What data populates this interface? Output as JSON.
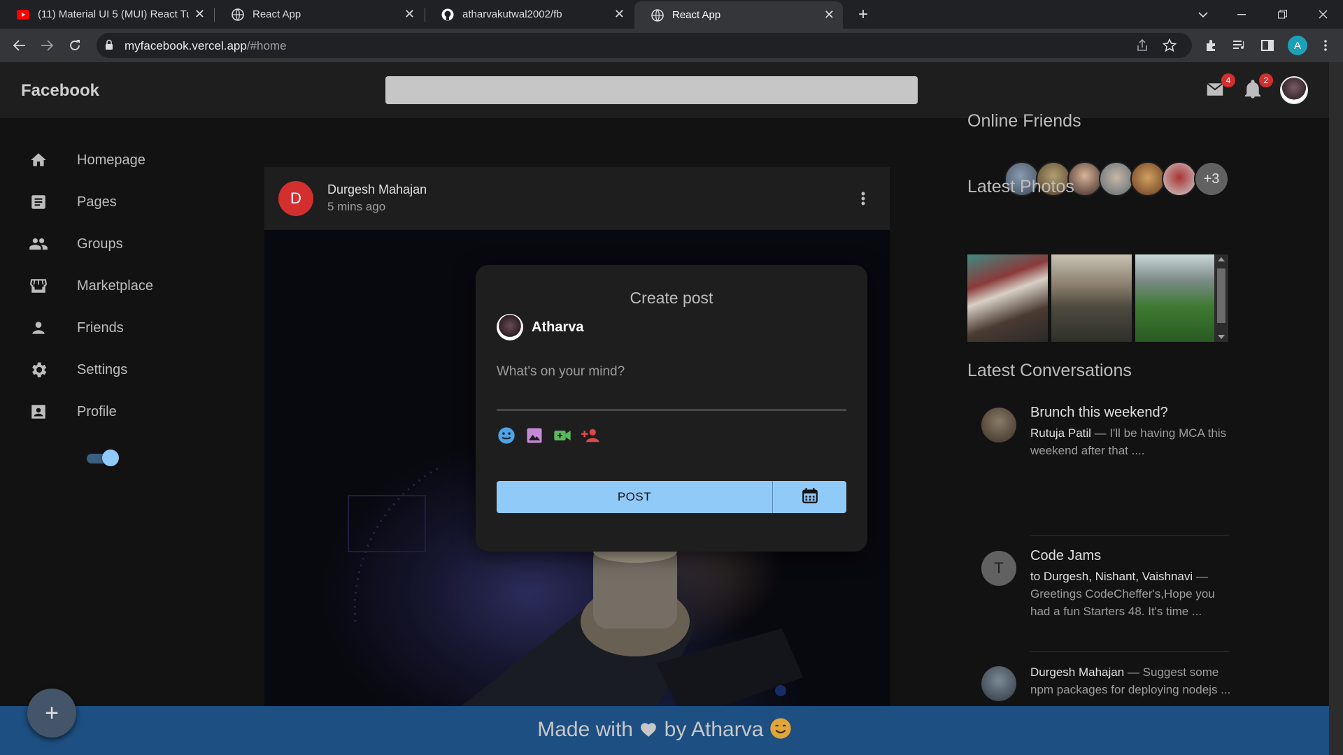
{
  "browser": {
    "tabs": [
      {
        "title": "(11) Material UI 5 (MUI) React Tu",
        "icon": "youtube-icon"
      },
      {
        "title": "React App",
        "icon": "globe-icon"
      },
      {
        "title": "atharvakutwal2002/fb",
        "icon": "github-icon"
      },
      {
        "title": "React App",
        "icon": "globe-icon",
        "active": true
      }
    ],
    "url_host": "myfacebook.vercel.app",
    "url_path": "/#home",
    "profile_letter": "A"
  },
  "appbar": {
    "brand": "Facebook",
    "mail_count": "4",
    "notif_count": "2"
  },
  "sidebar": {
    "items": [
      {
        "label": "Homepage",
        "icon": "home-icon"
      },
      {
        "label": "Pages",
        "icon": "article-icon"
      },
      {
        "label": "Groups",
        "icon": "group-icon"
      },
      {
        "label": "Marketplace",
        "icon": "storefront-icon"
      },
      {
        "label": "Friends",
        "icon": "person-icon"
      },
      {
        "label": "Settings",
        "icon": "settings-icon"
      },
      {
        "label": "Profile",
        "icon": "account-box-icon"
      }
    ],
    "dark_mode": true
  },
  "post": {
    "avatar_letter": "D",
    "author": "Durgesh Mahajan",
    "time": "5 mins ago"
  },
  "rail": {
    "online_title": "Online Friends",
    "online_more": "+3",
    "photos_title": "Latest Photos",
    "convos_title": "Latest Conversations",
    "conversations": [
      {
        "title": "Brunch this weekend?",
        "who": "Rutuja Patil",
        "text": " — I'll be having MCA this weekend after that ...."
      },
      {
        "title": "Code Jams",
        "avatar_letter": "T",
        "who": "to Durgesh, Nishant, Vaishnavi",
        "text": " — Greetings CodeCheffer's,Hope you had a fun Starters 48. It's time ..."
      },
      {
        "title": "",
        "who": "Durgesh Mahajan",
        "text": " — Suggest some npm packages for deploying nodejs ..."
      }
    ]
  },
  "modal": {
    "title": "Create post",
    "user": "Atharva",
    "placeholder": "What's on your mind?",
    "post_label": "POST"
  },
  "footer": {
    "text_before": "Made with",
    "text_after": "by Atharva"
  },
  "fab_label": "+",
  "colors": {
    "accent": "#90caf9",
    "footer": "#1d4f82",
    "badge": "#d32f2f"
  }
}
